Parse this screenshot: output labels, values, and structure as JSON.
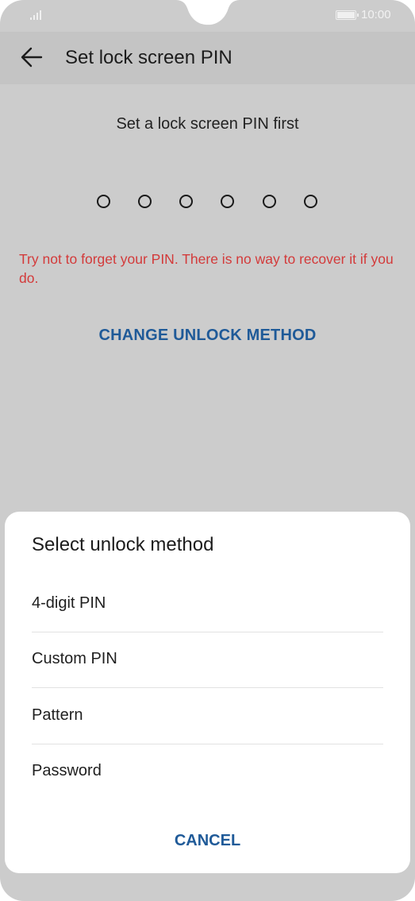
{
  "status_bar": {
    "time": "10:00"
  },
  "app_bar": {
    "title": "Set lock screen PIN"
  },
  "main": {
    "subtitle": "Set a lock screen PIN first",
    "pin_length_shown": 6,
    "warning": "Try not to forget your PIN. There is no way to recover it if you do.",
    "change_method_label": "CHANGE UNLOCK METHOD"
  },
  "dialog": {
    "title": "Select unlock method",
    "options": [
      {
        "label": "4-digit PIN"
      },
      {
        "label": "Custom PIN"
      },
      {
        "label": "Pattern"
      },
      {
        "label": "Password"
      }
    ],
    "cancel_label": "CANCEL"
  },
  "colors": {
    "accent": "#1f5a98",
    "warning": "#d33a3a",
    "scrim": "#cccccc"
  },
  "icons": {
    "back": "arrow-left-icon",
    "signal": "signal-icon",
    "battery": "battery-icon"
  }
}
